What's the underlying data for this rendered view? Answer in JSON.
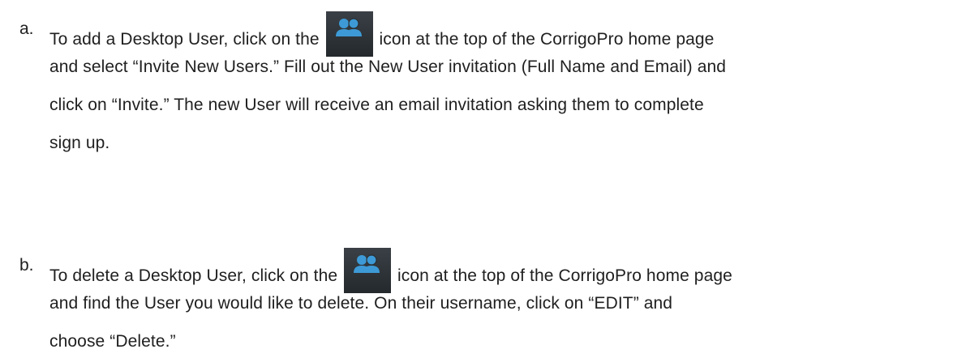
{
  "items": [
    {
      "marker": "a.",
      "before_icon": "To add a Desktop User, click on the",
      "icon": "users-icon",
      "lines": [
        "icon at the top of the CorrigoPro home page",
        "and select “Invite New Users.” Fill out the New User invitation (Full Name and Email) and",
        "click on “Invite.” The new User will receive an email invitation asking them to complete",
        "sign up."
      ]
    },
    {
      "marker": "b.",
      "before_icon": "To delete a Desktop User, click on the",
      "icon": "users-icon",
      "lines": [
        "icon at the top of the CorrigoPro home page",
        "and find the User you would like to delete. On their username, click on “EDIT” and",
        "choose “Delete.”"
      ]
    }
  ],
  "colors": {
    "text": "#1f1f1f",
    "icon_bg": "#2a2f33",
    "icon_fg": "#3d9ad6"
  }
}
